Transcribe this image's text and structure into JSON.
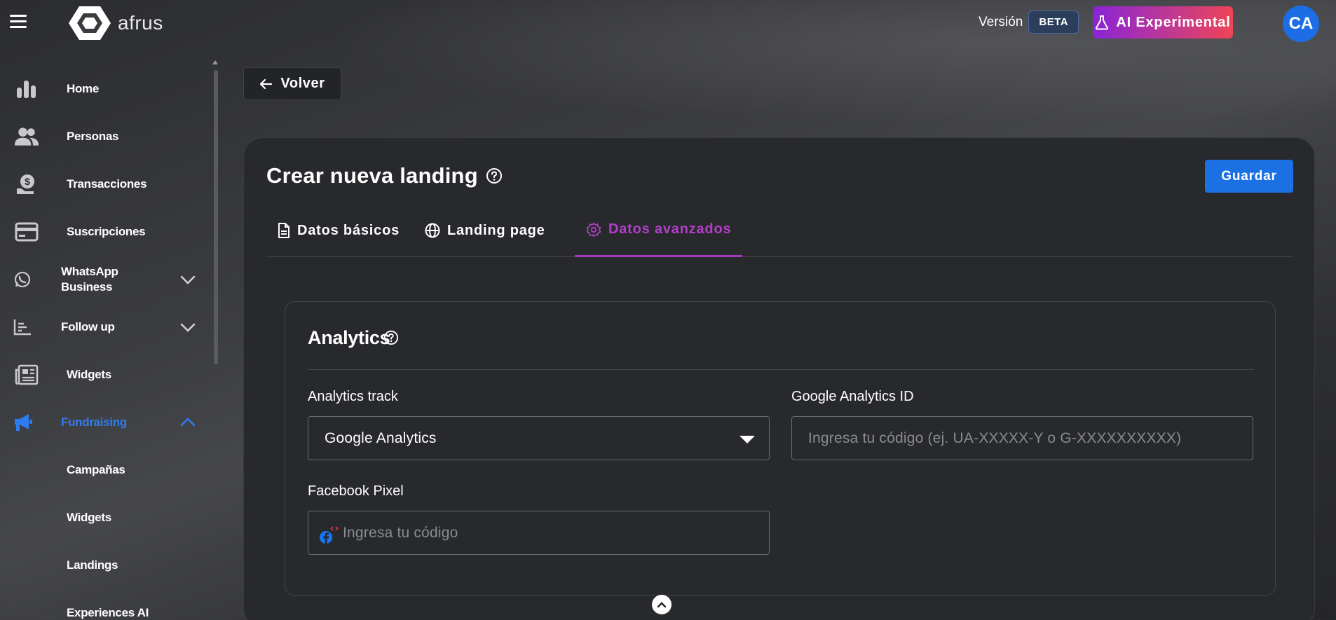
{
  "header": {
    "logo_text": "afrus",
    "version_label": "Versión",
    "beta_badge": "BETA",
    "ai_button_label": "AI Experimental",
    "avatar_initials": "CA"
  },
  "sidebar": {
    "items": [
      {
        "label": "Home",
        "icon": "bar-chart-icon"
      },
      {
        "label": "Personas",
        "icon": "people-icon"
      },
      {
        "label": "Transacciones",
        "icon": "money-hand-icon"
      },
      {
        "label": "Suscripciones",
        "icon": "credit-card-icon"
      },
      {
        "label": "WhatsApp Business",
        "icon": "whatsapp-icon",
        "expandable": true
      },
      {
        "label": "Follow up",
        "icon": "list-chart-icon",
        "expandable": true
      },
      {
        "label": "Widgets",
        "icon": "newspaper-icon"
      },
      {
        "label": "Fundraising",
        "icon": "megaphone-icon",
        "expandable": true,
        "expanded": true,
        "active": true
      },
      {
        "label": "Campañas"
      },
      {
        "label": "Widgets"
      },
      {
        "label": "Landings"
      },
      {
        "label": "Experiences AI"
      }
    ],
    "whatsapp_line1": "WhatsApp",
    "whatsapp_line2": "Business",
    "active_color": "#2f7bf0"
  },
  "back_button_label": "Volver",
  "page": {
    "title": "Crear nueva landing",
    "save_label": "Guardar",
    "tabs": [
      {
        "label": "Datos básicos",
        "icon": "document-icon"
      },
      {
        "label": "Landing page",
        "icon": "globe-icon"
      },
      {
        "label": "Datos avanzados",
        "icon": "gear-icon",
        "active": true
      }
    ],
    "active_tab_color": "#b23fc9"
  },
  "analytics": {
    "title": "Analytics",
    "track_label": "Analytics track",
    "track_value": "Google Analytics",
    "ga_label": "Google Analytics ID",
    "ga_placeholder": "Ingresa tu código (ej. UA-XXXXX-Y o G-XXXXXXXXXX)",
    "fb_label": "Facebook Pixel",
    "fb_placeholder": "Ingresa tu código"
  },
  "colors": {
    "primary_button": "#1b71e4",
    "ai_gradient_start": "#8a24d6",
    "ai_gradient_end": "#ee4456"
  }
}
